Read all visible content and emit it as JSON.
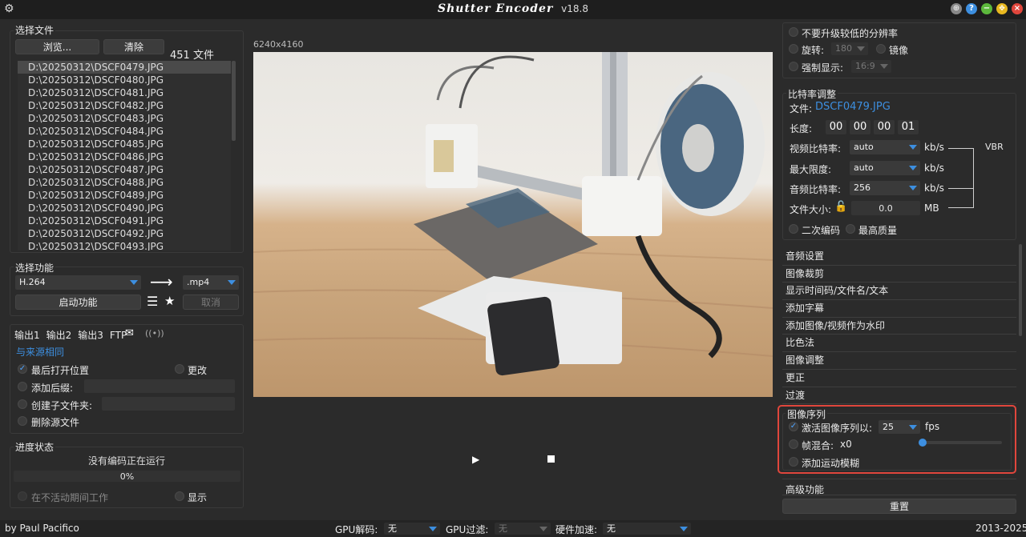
{
  "title": {
    "app": "Shutter Encoder",
    "version": "v18.8"
  },
  "file_section": {
    "heading": "选择文件",
    "browse_label": "浏览...",
    "clear_label": "清除",
    "count_label": "451 文件",
    "files": [
      "D:\\20250312\\DSCF0479.JPG",
      "D:\\20250312\\DSCF0480.JPG",
      "D:\\20250312\\DSCF0481.JPG",
      "D:\\20250312\\DSCF0482.JPG",
      "D:\\20250312\\DSCF0483.JPG",
      "D:\\20250312\\DSCF0484.JPG",
      "D:\\20250312\\DSCF0485.JPG",
      "D:\\20250312\\DSCF0486.JPG",
      "D:\\20250312\\DSCF0487.JPG",
      "D:\\20250312\\DSCF0488.JPG",
      "D:\\20250312\\DSCF0489.JPG",
      "D:\\20250312\\DSCF0490.JPG",
      "D:\\20250312\\DSCF0491.JPG",
      "D:\\20250312\\DSCF0492.JPG",
      "D:\\20250312\\DSCF0493.JPG"
    ]
  },
  "function_section": {
    "heading": "选择功能",
    "codec": "H.264",
    "extension": ".mp4",
    "start_label": "启动功能",
    "cancel_label": "取消"
  },
  "output_section": {
    "tabs": [
      "输出1",
      "输出2",
      "输出3",
      "FTP"
    ],
    "same_as_source": "与来源相同",
    "last_open_location": "最后打开位置",
    "change_label": "更改",
    "add_suffix": "添加后缀:",
    "create_subfolder": "创建子文件夹:",
    "delete_source": "删除源文件"
  },
  "progress_section": {
    "heading": "进度状态",
    "status": "没有编码正在运行",
    "percent": "0%",
    "progress": 0,
    "work_inactive": "在不活动期间工作",
    "show_label": "显示"
  },
  "preview": {
    "resolution": "6240x4160"
  },
  "right_top": {
    "no_upscale": "不要升级较低的分辨率",
    "rotate_label": "旋转:",
    "rotate_value": "180",
    "mirror_label": "镜像",
    "force_display_label": "强制显示:",
    "force_display_value": "16:9"
  },
  "bitrate": {
    "heading": "比特率调整",
    "file_label": "文件:",
    "file_name": "DSCF0479.JPG",
    "length_label": "长度:",
    "length": [
      "00",
      "00",
      "00",
      "01"
    ],
    "video_bitrate_label": "视频比特率:",
    "video_bitrate": "auto",
    "max_limit_label": "最大限度:",
    "max_limit": "auto",
    "audio_bitrate_label": "音频比特率:",
    "audio_bitrate": "256",
    "unit_kbs": "kb/s",
    "vbr": "VBR",
    "file_size_label": "文件大小:",
    "file_size": "0.0",
    "unit_mb": "MB",
    "two_pass": "二次编码",
    "best_quality": "最高质量"
  },
  "sections": [
    "音频设置",
    "图像裁剪",
    "显示时间码/文件名/文本",
    "添加字幕",
    "添加图像/视频作为水印",
    "比色法",
    "图像调整",
    "更正",
    "过渡"
  ],
  "image_sequence": {
    "heading": "图像序列",
    "activate_label": "激活图像序列以:",
    "fps_value": "25",
    "fps_unit": "fps",
    "blend_label": "帧混合:",
    "blend_value": "x0",
    "blend_level": 0,
    "motion_blur": "添加运动模糊"
  },
  "advanced_label": "高级功能",
  "reset_label": "重置",
  "footer": {
    "author": "by Paul Pacifico",
    "gpu_decode_label": "GPU解码:",
    "gpu_decode": "无",
    "gpu_filter_label": "GPU过滤:",
    "gpu_filter": "无",
    "hw_accel_label": "硬件加速:",
    "hw_accel": "无",
    "years": "2013-2025"
  },
  "colors": {
    "accent": "#3d8fe0",
    "highlight_border": "#e0463c",
    "close": "#e0463c",
    "minimize": "#5cb83c",
    "restore": "#e8b820",
    "help": "#3d8fe0"
  }
}
